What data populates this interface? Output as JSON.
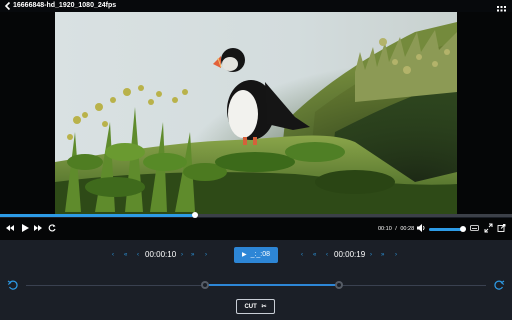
{
  "header": {
    "title": "16666848-hd_1920_1080_24fps",
    "back_icon": "arrow-left-icon",
    "menu_icon": "grid-icon"
  },
  "player": {
    "progress": 0.38,
    "time_current": "00:10",
    "time_separator": "/",
    "time_total": "00:28",
    "volume": 0.92,
    "controls": {
      "prev": "◂◂",
      "play": "▶",
      "next": "▸▸",
      "replay": "↻"
    }
  },
  "editor": {
    "start_time": "00:00:10",
    "end_time": "00:00:19",
    "play_label": "_:_:08",
    "nav_left": [
      "‹",
      "«",
      "‹"
    ],
    "nav_left_after": [
      "›",
      "»",
      "›"
    ],
    "nav_right": [
      "‹",
      "«",
      "‹"
    ],
    "nav_right_after": [
      "›",
      "»",
      "›"
    ],
    "range_start": 0.39,
    "range_end": 0.68,
    "cut_label": "CUT",
    "accent": "#2d9be6"
  }
}
